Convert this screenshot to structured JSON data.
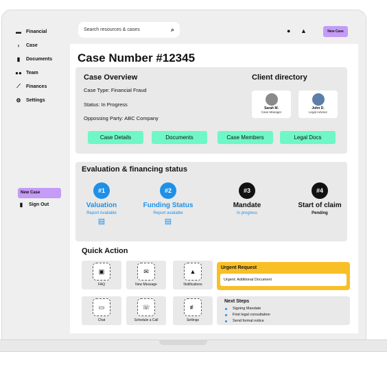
{
  "sidebar": {
    "items": [
      {
        "label": "Financial",
        "icon": "card-icon"
      },
      {
        "label": "Case",
        "icon": "chevron-right-icon"
      },
      {
        "label": "Documents",
        "icon": "document-icon"
      },
      {
        "label": "Team",
        "icon": "team-icon"
      },
      {
        "label": "Finances",
        "icon": "chart-icon"
      },
      {
        "label": "Settings",
        "icon": "gear-icon"
      }
    ],
    "new_case": "New Case",
    "sign_out": "Sign Out"
  },
  "header": {
    "search_placeholder": "Search resources & cases",
    "new_case": "New Case"
  },
  "case": {
    "title": "Case Number #12345"
  },
  "overview": {
    "title": "Case Overview",
    "case_type": "Case Type: Financial Fraud",
    "status": "Status: In Progress",
    "opposing": "Oppossing Party: ABC Company",
    "buttons": [
      "Case Details",
      "Documents",
      "Case Members",
      "Legal Docs"
    ]
  },
  "client_directory": {
    "title": "Client directory",
    "clients": [
      {
        "name": "Sarah M.",
        "role": "Case Manager"
      },
      {
        "name": "John D.",
        "role": "Legal Advisor"
      }
    ]
  },
  "evaluation": {
    "title": "Evaluation & financing status",
    "steps": [
      {
        "num": "#1",
        "label": "Valuation",
        "sub": "Report Available",
        "active": true
      },
      {
        "num": "#2",
        "label": "Funding Status",
        "sub": "Report available",
        "active": true
      },
      {
        "num": "#3",
        "label": "Mandate",
        "sub": "In progress",
        "active": false
      },
      {
        "num": "#4",
        "label": "Start of claim",
        "sub": "Pending",
        "active": false
      }
    ]
  },
  "quick_action": {
    "title": "Quick Action",
    "tiles": [
      "FAQ",
      "New Message",
      "Notifications",
      "Chat",
      "Schedule a Call",
      "Settings"
    ]
  },
  "urgent": {
    "title": "Urgent Request",
    "item": "Urgent: Additional Document"
  },
  "next_steps": {
    "title": "Next Steps",
    "items": [
      "Signing Mandate",
      "First legal consultation",
      "Send formal notice"
    ]
  },
  "colors": {
    "accent_purple": "#c49bf7",
    "accent_green": "#6ff7c7",
    "accent_blue": "#1e90e8",
    "urgent_yellow": "#f9bf26"
  }
}
